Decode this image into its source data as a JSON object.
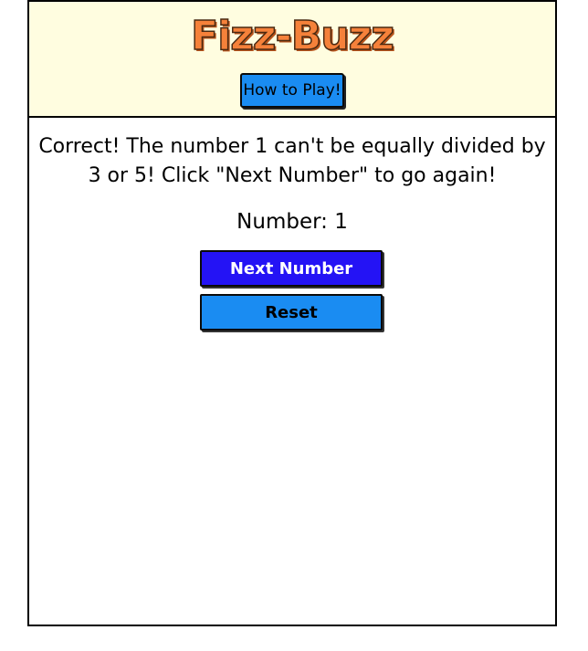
{
  "header": {
    "title": "Fizz-Buzz",
    "how_to_play_label": "How to Play!"
  },
  "game": {
    "message_line1": "Correct! The number 1 can't be equally divided by",
    "message_line2": "3 or 5! Click \"Next Number\" to go again!",
    "number_label": "Number: 1"
  },
  "controls": {
    "next_label": "Next Number",
    "reset_label": "Reset"
  },
  "colors": {
    "header_bg": "#fffde0",
    "title_orange": "#f5813a",
    "next_button_bg": "#2413f5",
    "secondary_button_bg": "#1a8cf2"
  }
}
